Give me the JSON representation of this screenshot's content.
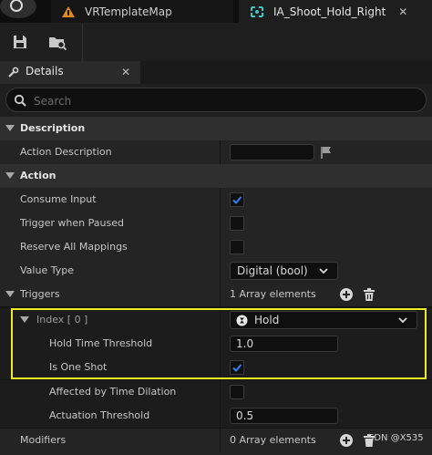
{
  "tabs": [
    {
      "label": "VRTemplateMap",
      "icon": "level-map-icon"
    },
    {
      "label": "IA_Shoot_Hold_Right",
      "icon": "input-action-icon",
      "active": true
    }
  ],
  "toolbar": {
    "buttons": [
      "save-icon",
      "browse-to-asset-icon"
    ]
  },
  "panel": {
    "title": "Details"
  },
  "search": {
    "placeholder": "Search"
  },
  "sections": {
    "description": {
      "title": "Description",
      "action_description": {
        "label": "Action Description",
        "value": ""
      }
    },
    "action": {
      "title": "Action",
      "consume_input": {
        "label": "Consume Input",
        "checked": true
      },
      "trigger_when_paused": {
        "label": "Trigger when Paused",
        "checked": false
      },
      "reserve_all_mappings": {
        "label": "Reserve All Mappings",
        "checked": false
      },
      "value_type": {
        "label": "Value Type",
        "value": "Digital (bool)"
      }
    },
    "triggers": {
      "title": "Triggers",
      "count": "1 Array elements",
      "index": {
        "label": "Index [ 0 ]",
        "value": "Hold",
        "hold_time_threshold": {
          "label": "Hold Time Threshold",
          "value": "1.0"
        },
        "is_one_shot": {
          "label": "Is One Shot",
          "checked": true
        },
        "affected_by_time_dilation": {
          "label": "Affected by Time Dilation",
          "checked": false
        },
        "actuation_threshold": {
          "label": "Actuation Threshold",
          "value": "0.5"
        }
      }
    },
    "modifiers": {
      "label": "Modifiers",
      "count": "0 Array elements"
    }
  },
  "watermark": "SDN @X535",
  "colors": {
    "accent": "#2f80ed",
    "highlight_box": "#f0ea25",
    "tab_map_icon": "#e08a1e",
    "tab_asset_icon": "#3fc7c7"
  }
}
